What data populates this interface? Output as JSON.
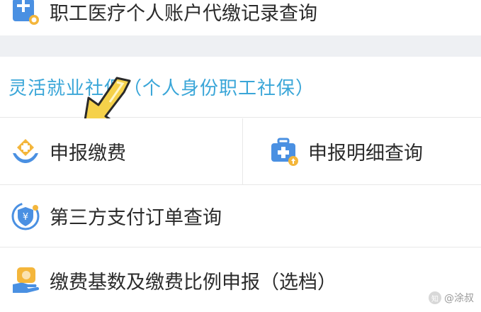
{
  "items": {
    "top": "职工医疗个人账户代缴记录查询",
    "declare_pay": "申报缴费",
    "declare_detail": "申报明细查询",
    "third_party": "第三方支付订单查询",
    "base_ratio": "缴费基数及缴费比例申报（选档）"
  },
  "section": {
    "title": "灵活就业社保（个人身份职工社保）"
  },
  "watermark": {
    "logo": "知",
    "text": "@涂叔"
  },
  "colors": {
    "accent": "#3aa6d8",
    "arrow": "#f5d14a",
    "divider_bg": "#eef0f3"
  },
  "icons": [
    "medical-record-search-icon",
    "blue-hands-plus-icon",
    "medical-kit-up-icon",
    "shield-yuan-icon",
    "hand-card-icon",
    "pointing-arrow-icon"
  ]
}
